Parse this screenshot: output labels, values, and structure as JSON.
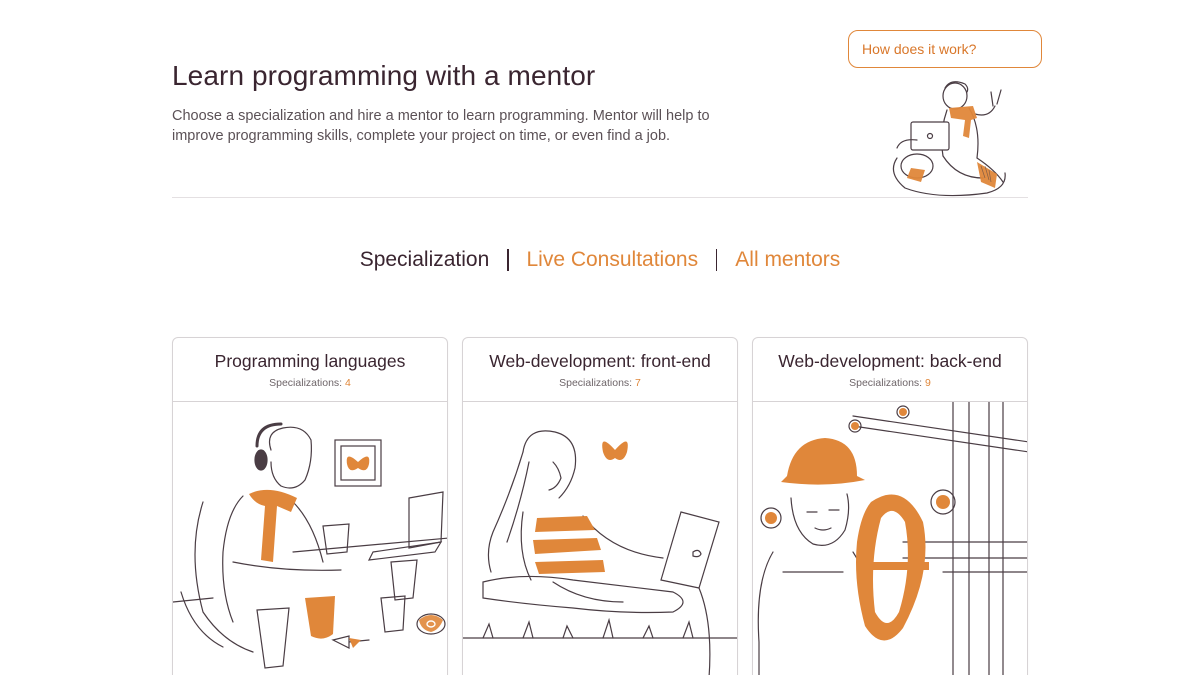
{
  "header": {
    "title": "Learn programming with a mentor",
    "description": "Choose a specialization and hire a mentor to learn programming. Mentor will help to improve programming skills, complete your project on time, or even find a job.",
    "help_bubble": "How does it work?"
  },
  "tabs": [
    {
      "label": "Specialization",
      "active": true
    },
    {
      "label": "Live Consultations",
      "active": false
    },
    {
      "label": "All mentors",
      "active": false
    }
  ],
  "cards": [
    {
      "title": "Programming languages",
      "count_label": "Specializations:",
      "count": "4"
    },
    {
      "title": "Web-development: front-end",
      "count_label": "Specializations:",
      "count": "7"
    },
    {
      "title": "Web-development: back-end",
      "count_label": "Specializations:",
      "count": "9"
    }
  ],
  "colors": {
    "accent": "#e0873a",
    "text": "#3a2530",
    "muted": "#6d6468",
    "line": "#4a3d44"
  }
}
